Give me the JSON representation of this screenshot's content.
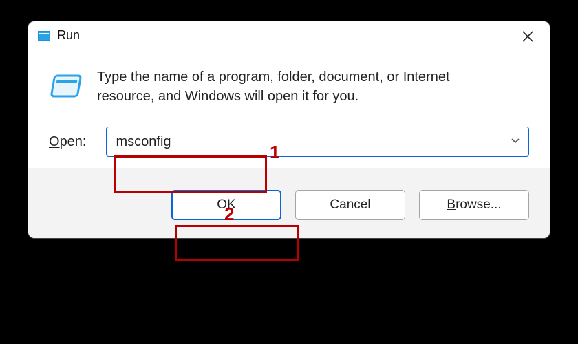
{
  "window": {
    "title": "Run",
    "close_tooltip": "Close"
  },
  "content": {
    "instruction": "Type the name of a program, folder, document, or Internet resource, and Windows will open it for you.",
    "open_label_prefix": "O",
    "open_label_rest": "pen:"
  },
  "input": {
    "value": "msconfig"
  },
  "buttons": {
    "ok": "OK",
    "cancel": "Cancel",
    "browse_prefix": "B",
    "browse_rest": "rowse..."
  },
  "annotations": {
    "step1": "1",
    "step2": "2"
  }
}
